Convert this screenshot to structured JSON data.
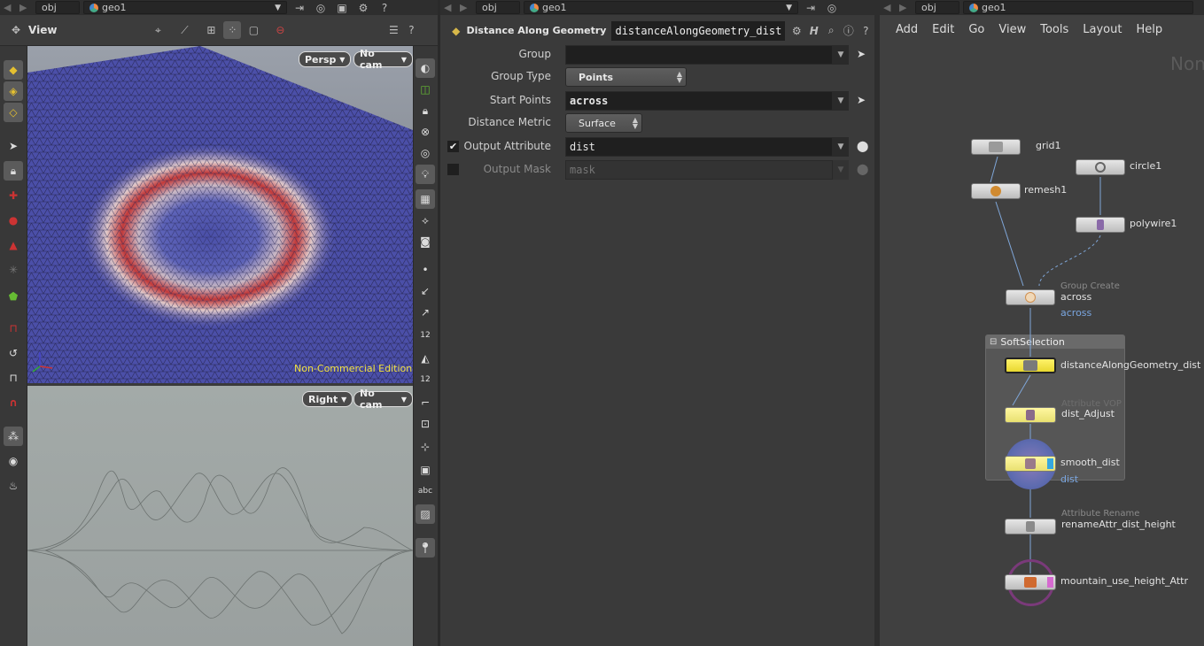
{
  "left_pane": {
    "path": {
      "obj": "obj",
      "geo": "geo1"
    },
    "toolbar": {
      "view_label": "View"
    },
    "viewport_top": {
      "cam_view": "Persp",
      "cam_select": "No cam",
      "watermark": "Non-Commercial Edition"
    },
    "viewport_bottom": {
      "cam_view": "Right",
      "cam_select": "No cam"
    },
    "right_strip_text": {
      "n1": "12",
      "n2": "12",
      "abc": "abc"
    }
  },
  "parameters": {
    "path": {
      "obj": "obj",
      "geo": "geo1"
    },
    "node_type": "Distance Along Geometry",
    "node_name": "distanceAlongGeometry_dist",
    "rows": {
      "group": {
        "label": "Group",
        "value": ""
      },
      "group_type": {
        "label": "Group Type",
        "value": "Points"
      },
      "start_points": {
        "label": "Start Points",
        "value": "across"
      },
      "distance_metric": {
        "label": "Distance Metric",
        "value": "Surface"
      },
      "output_attribute": {
        "label": "Output Attribute",
        "value": "dist",
        "enabled": true
      },
      "output_mask": {
        "label": "Output Mask",
        "placeholder": "mask",
        "enabled": false
      }
    }
  },
  "network": {
    "path": {
      "obj": "obj",
      "geo": "geo1"
    },
    "menu": [
      "Add",
      "Edit",
      "Go",
      "View",
      "Tools",
      "Layout",
      "Help"
    ],
    "watermark": "Non",
    "group_box_title": "SoftSelection",
    "nodes": {
      "grid1": {
        "name": "grid1"
      },
      "circle1": {
        "name": "circle1"
      },
      "remesh1": {
        "name": "remesh1"
      },
      "polywire1": {
        "name": "polywire1"
      },
      "across": {
        "type": "Group Create",
        "name": "across",
        "sub": "across"
      },
      "dist_along": {
        "name": "distanceAlongGeometry_dist"
      },
      "dist_adjust": {
        "type": "Attribute VOP",
        "name": "dist_Adjust"
      },
      "smooth_dist": {
        "name": "smooth_dist",
        "sub": "dist"
      },
      "rename": {
        "type": "Attribute Rename",
        "name": "renameAttr_dist_height"
      },
      "mountain": {
        "name": "mountain_use_height_Attr"
      }
    }
  },
  "colors": {
    "highlight_node": "#f2e24a",
    "display_flag": "#35a7e0",
    "render_flag": "#d56ad0",
    "accent_blue": "#7aa6e0"
  }
}
